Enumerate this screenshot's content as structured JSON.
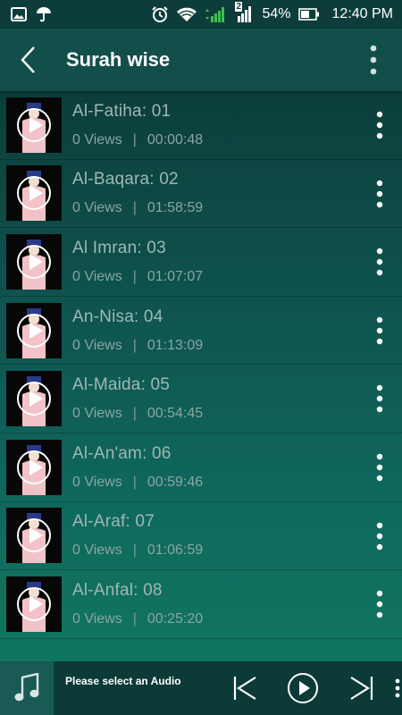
{
  "status_bar": {
    "battery": "54%",
    "time": "12:40 PM",
    "sim2_label": "2",
    "icons": [
      "image-icon",
      "umbrella-icon",
      "alarm-icon",
      "wifi-icon",
      "signal-icon",
      "battery-icon"
    ]
  },
  "app_bar": {
    "title": "Surah wise",
    "icons": [
      "back-arrow-icon",
      "more-vertical-icon"
    ]
  },
  "surahs": [
    {
      "name": "Al-Fatiha: 01",
      "views": "0 Views",
      "duration": "00:00:48"
    },
    {
      "name": "Al-Baqara: 02",
      "views": "0 Views",
      "duration": "01:58:59"
    },
    {
      "name": "Al Imran: 03",
      "views": "0 Views",
      "duration": "01:07:07"
    },
    {
      "name": "An-Nisa: 04",
      "views": "0 Views",
      "duration": "01:13:09"
    },
    {
      "name": "Al-Maida: 05",
      "views": "0 Views",
      "duration": "00:54:45"
    },
    {
      "name": "Al-An'am: 06",
      "views": "0 Views",
      "duration": "00:59:46"
    },
    {
      "name": "Al-Araf: 07",
      "views": "0 Views",
      "duration": "01:06:59"
    },
    {
      "name": "Al-Anfal: 08",
      "views": "0 Views",
      "duration": "00:25:20"
    }
  ],
  "list_separator": "|",
  "player": {
    "status_text": "Please select an Audio",
    "icons": [
      "music-note-icon",
      "skip-previous-icon",
      "play-icon",
      "skip-next-icon"
    ]
  },
  "colors": {
    "status_bar": "#0d3d3a",
    "app_bar": "#134f4a",
    "list_top": "#0c3e3b",
    "list_bottom": "#10765f",
    "player_bar": "#0b3a37",
    "secondary_text": "#9fb8b4"
  }
}
